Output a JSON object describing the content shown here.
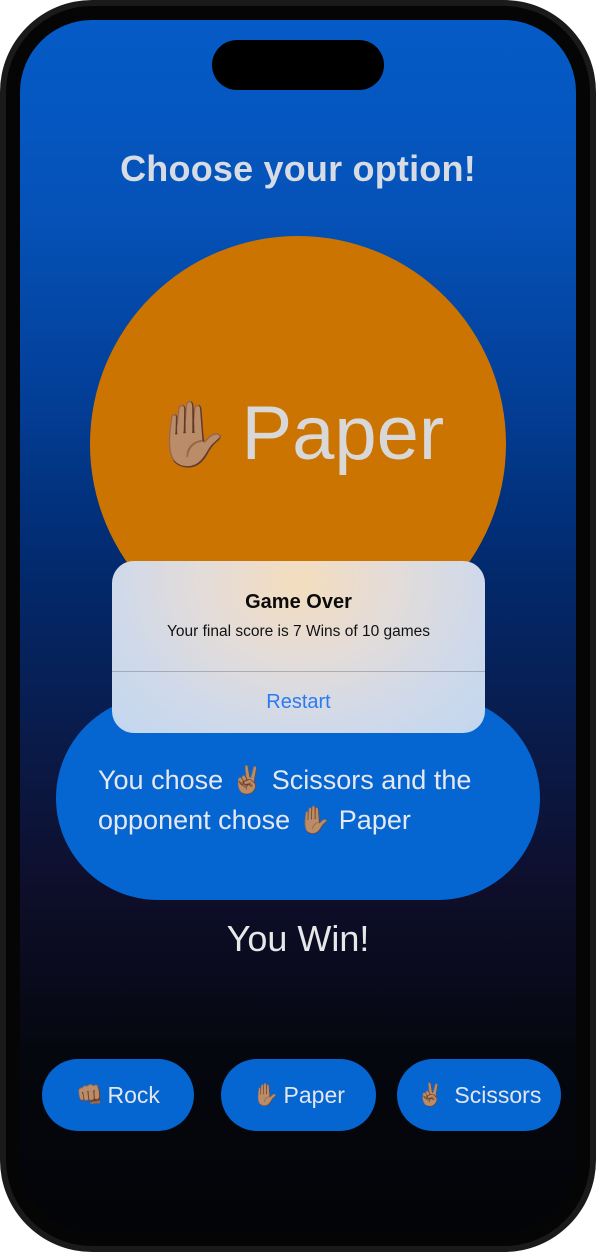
{
  "header": {
    "title": "Choose your option!"
  },
  "current_choice": {
    "emoji": "✋🏽",
    "label": "Paper",
    "icon": "raised-hand-icon"
  },
  "result": {
    "text_line1_prefix": "You chose ",
    "user_emoji": "✌🏽",
    "text_line1_suffix": " Scissors and the",
    "text_line2_prefix": "opponent chose ",
    "opponent_emoji": "✋🏽",
    "text_line2_suffix": " Paper",
    "outcome": "You Win!"
  },
  "buttons": [
    {
      "emoji": "👊🏽",
      "label": "Rock",
      "icon": "fist-icon"
    },
    {
      "emoji": "✋🏽",
      "label": "Paper",
      "icon": "raised-hand-icon"
    },
    {
      "emoji": "✌🏽",
      "label": " Scissors",
      "icon": "victory-hand-icon"
    }
  ],
  "alert": {
    "title": "Game Over",
    "message": "Your final score is 7 Wins of 10 games",
    "button_label": "Restart"
  },
  "colors": {
    "accent_blue": "#0565d1",
    "choice_orange": "#cc7402",
    "alert_link": "#2a7bf0"
  }
}
